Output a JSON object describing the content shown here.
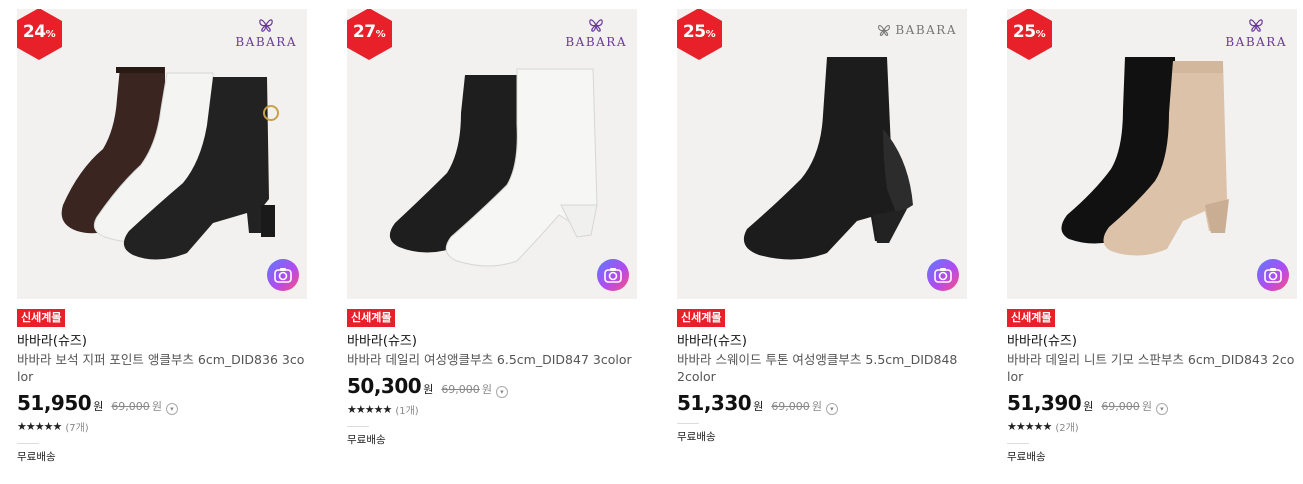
{
  "products": [
    {
      "discount": "24",
      "percent": "%",
      "brand_logo": "BABARA",
      "tag": "신세계몰",
      "brand": "바바라(슈즈)",
      "title": "바바라 보석 지퍼 포인트 앵클부츠 6cm_DID836 3color",
      "price": "51,950",
      "won": "원",
      "original_price": "69,000",
      "stars": "★★★★★",
      "review_count": "(7개)",
      "shipping": "무료배송"
    },
    {
      "discount": "27",
      "percent": "%",
      "brand_logo": "BABARA",
      "tag": "신세계몰",
      "brand": "바바라(슈즈)",
      "title": "바바라 데일리 여성앵클부츠 6.5cm_DID847 3color",
      "price": "50,300",
      "won": "원",
      "original_price": "69,000",
      "stars": "★★★★★",
      "review_count": "(1개)",
      "shipping": "무료배송"
    },
    {
      "discount": "25",
      "percent": "%",
      "brand_logo": "BABARA",
      "tag": "신세계몰",
      "brand": "바바라(슈즈)",
      "title": "바바라 스웨이드 투톤 여성앵클부츠 5.5cm_DID848 2color",
      "price": "51,330",
      "won": "원",
      "original_price": "69,000",
      "stars": "",
      "review_count": "",
      "shipping": "무료배송"
    },
    {
      "discount": "25",
      "percent": "%",
      "brand_logo": "BABARA",
      "tag": "신세계몰",
      "brand": "바바라(슈즈)",
      "title": "바바라 데일리 니트 기모 스판부츠 6cm_DID843 2color",
      "price": "51,390",
      "won": "원",
      "original_price": "69,000",
      "stars": "★★★★★",
      "review_count": "(2개)",
      "shipping": "무료배송"
    }
  ],
  "icons": {
    "badge": "red-hexagon-badge",
    "camera": "camera-icon",
    "info": "info-icon",
    "logo": "butterfly-logo"
  },
  "colors": {
    "badge_red": "#e8202a",
    "tag_red": "#e8202a",
    "logo_purple": "#6a3a9a"
  }
}
